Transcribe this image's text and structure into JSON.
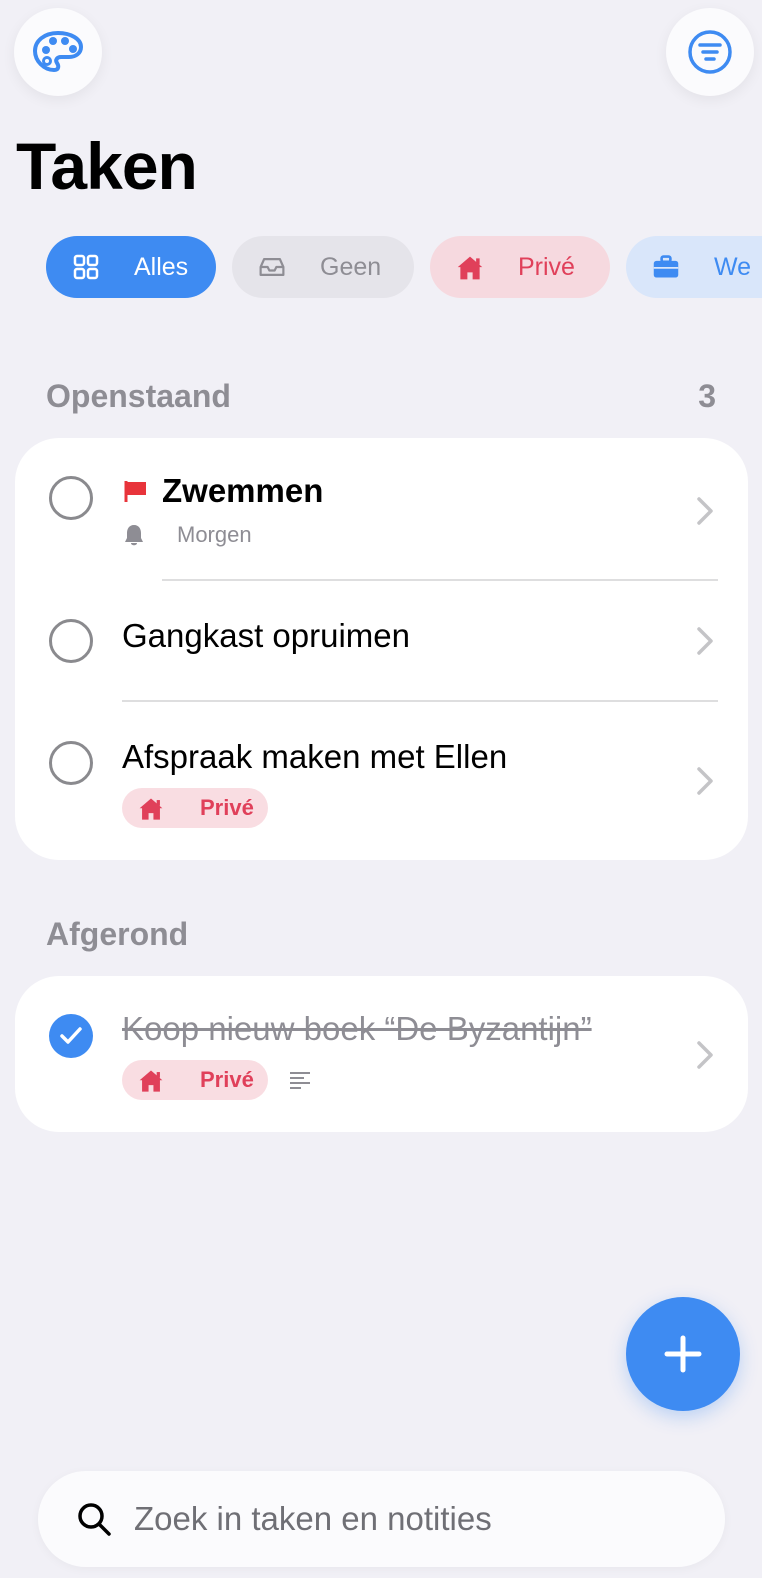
{
  "header": {
    "title": "Taken"
  },
  "filters": [
    {
      "label": "Alles",
      "icon": "grid-icon"
    },
    {
      "label": "Geen",
      "icon": "inbox-tray-icon"
    },
    {
      "label": "Privé",
      "icon": "house-icon"
    },
    {
      "label": "We",
      "icon": "briefcase-icon"
    }
  ],
  "open_section": {
    "title": "Openstaand",
    "count": "3",
    "tasks": [
      {
        "title": "Zwemmen",
        "flagged": true,
        "reminder": "Morgen"
      },
      {
        "title": "Gangkast opruimen"
      },
      {
        "title": "Afspraak maken met Ellen",
        "tag": "Privé"
      }
    ]
  },
  "done_section": {
    "title": "Afgerond",
    "tasks": [
      {
        "title": "Koop nieuw boek “De Byzantijn”",
        "tag": "Privé",
        "has_notes": true
      }
    ]
  },
  "search": {
    "placeholder": "Zoek in taken en notities"
  },
  "colors": {
    "accent": "#3e8bf2",
    "private": "#e0405a",
    "private_bg": "#f6d9df",
    "flag": "#e8343b",
    "background": "#f1f0f6"
  }
}
